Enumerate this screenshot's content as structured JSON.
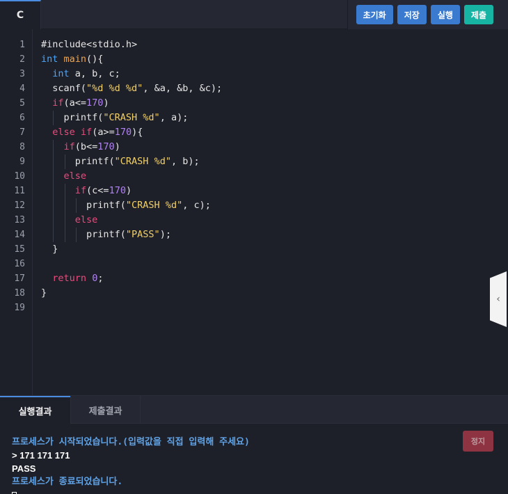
{
  "topbar": {
    "file_tab": "C",
    "buttons": {
      "reset": "초기화",
      "save": "저장",
      "run": "실행",
      "submit": "제출"
    }
  },
  "editor": {
    "line_numbers": [
      "1",
      "2",
      "3",
      "4",
      "5",
      "6",
      "7",
      "8",
      "9",
      "10",
      "11",
      "12",
      "13",
      "14",
      "15",
      "16",
      "17",
      "18",
      "19"
    ],
    "lines": [
      [
        [
          "p",
          "#include<stdio.h>"
        ]
      ],
      [
        [
          "ty",
          "int"
        ],
        [
          "op",
          " "
        ],
        [
          "fn",
          "main"
        ],
        [
          "op",
          "(){"
        ]
      ],
      [
        [
          "op",
          "  "
        ],
        [
          "ty",
          "int"
        ],
        [
          "op",
          " a, b, c;"
        ]
      ],
      [
        [
          "op",
          "  scanf("
        ],
        [
          "st",
          "\"%d %d %d\""
        ],
        [
          "op",
          ", &a, &b, &c);"
        ]
      ],
      [
        [
          "op",
          "  "
        ],
        [
          "kw",
          "if"
        ],
        [
          "op",
          "(a<="
        ],
        [
          "nu",
          "170"
        ],
        [
          "op",
          ")"
        ]
      ],
      [
        [
          "op",
          "    printf("
        ],
        [
          "st",
          "\"CRASH %d\""
        ],
        [
          "op",
          ", a);"
        ]
      ],
      [
        [
          "op",
          "  "
        ],
        [
          "kw",
          "else"
        ],
        [
          "op",
          " "
        ],
        [
          "kw",
          "if"
        ],
        [
          "op",
          "(a>="
        ],
        [
          "nu",
          "170"
        ],
        [
          "op",
          "){"
        ]
      ],
      [
        [
          "op",
          "    "
        ],
        [
          "kw",
          "if"
        ],
        [
          "op",
          "(b<="
        ],
        [
          "nu",
          "170"
        ],
        [
          "op",
          ")"
        ]
      ],
      [
        [
          "op",
          "      printf("
        ],
        [
          "st",
          "\"CRASH %d\""
        ],
        [
          "op",
          ", b);"
        ]
      ],
      [
        [
          "op",
          "    "
        ],
        [
          "kw",
          "else"
        ]
      ],
      [
        [
          "op",
          "      "
        ],
        [
          "kw",
          "if"
        ],
        [
          "op",
          "(c<="
        ],
        [
          "nu",
          "170"
        ],
        [
          "op",
          ")"
        ]
      ],
      [
        [
          "op",
          "        printf("
        ],
        [
          "st",
          "\"CRASH %d\""
        ],
        [
          "op",
          ", c);"
        ]
      ],
      [
        [
          "op",
          "      "
        ],
        [
          "kw",
          "else"
        ]
      ],
      [
        [
          "op",
          "        printf("
        ],
        [
          "st",
          "\"PASS\""
        ],
        [
          "op",
          ");"
        ]
      ],
      [
        [
          "op",
          "  }"
        ]
      ],
      [
        [
          "op",
          ""
        ]
      ],
      [
        [
          "op",
          "  "
        ],
        [
          "kw",
          "return"
        ],
        [
          "op",
          " "
        ],
        [
          "nu",
          "0"
        ],
        [
          "op",
          ";"
        ]
      ],
      [
        [
          "op",
          "}"
        ]
      ],
      [
        [
          "op",
          ""
        ]
      ]
    ],
    "guides": [
      [],
      [],
      [],
      [],
      [],
      [
        1
      ],
      [],
      [
        1
      ],
      [
        1,
        2
      ],
      [
        1
      ],
      [
        1,
        2
      ],
      [
        1,
        2,
        3
      ],
      [
        1,
        2
      ],
      [
        1,
        2,
        3
      ],
      [],
      [],
      [],
      [],
      []
    ],
    "side_handle": "‹"
  },
  "bottom": {
    "tabs": {
      "run_result": "실행결과",
      "submit_result": "제출결과"
    },
    "stop_label": "정지",
    "console": [
      {
        "kind": "msg",
        "text": "프로세스가 시작되었습니다.(입력값을 직접 입력해 주세요)"
      },
      {
        "kind": "out",
        "text": "> 171 171 171"
      },
      {
        "kind": "out",
        "text": "PASS"
      },
      {
        "kind": "msg",
        "text": "프로세스가 종료되었습니다."
      }
    ]
  },
  "colors": {
    "keyword": "#ef4a7c",
    "type": "#4aa6ff",
    "function": "#f0a34a",
    "string": "#f2d068",
    "number": "#b083f0",
    "accent": "#3a7bd0",
    "submit": "#17b3a3"
  }
}
